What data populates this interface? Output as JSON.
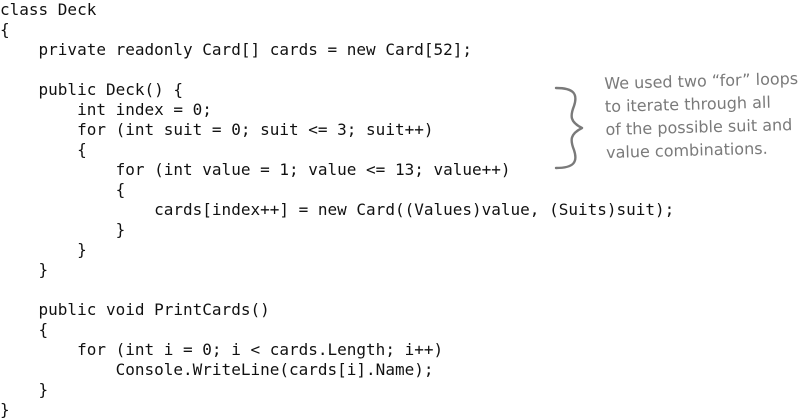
{
  "code": {
    "lines": [
      "class Deck",
      "{",
      "    private readonly Card[] cards = new Card[52];",
      "",
      "    public Deck() {",
      "        int index = 0;",
      "        for (int suit = 0; suit <= 3; suit++)",
      "        {",
      "            for (int value = 1; value <= 13; value++)",
      "            {",
      "                cards[index++] = new Card((Values)value, (Suits)suit);",
      "            }",
      "        }",
      "    }",
      "",
      "    public void PrintCards()",
      "    {",
      "        for (int i = 0; i < cards.Length; i++)",
      "            Console.WriteLine(cards[i].Name);",
      "    }",
      "}"
    ]
  },
  "annotation": {
    "lines": [
      "We used two “for” loops",
      "to iterate through all",
      "of the possible suit and",
      "value combinations."
    ],
    "brace_icon": "curly-brace-icon"
  }
}
